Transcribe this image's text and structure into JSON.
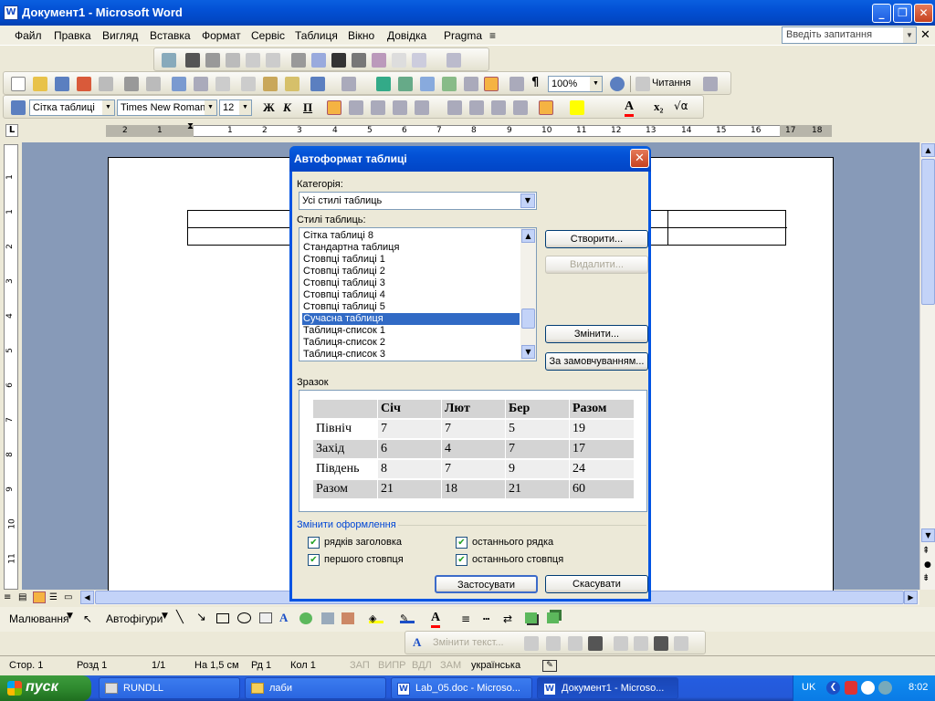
{
  "window": {
    "title": "Документ1 - Microsoft Word",
    "icon": "word-icon"
  },
  "menu": {
    "items": [
      "Файл",
      "Правка",
      "Вигляд",
      "Вставка",
      "Формат",
      "Сервіс",
      "Таблиця",
      "Вікно",
      "Довідка",
      "Pragma"
    ],
    "help_placeholder": "Введіть запитання"
  },
  "toolbar": {
    "zoom": "100%",
    "read_label": "Читання",
    "style": "Сітка таблиці",
    "font": "Times New Roman",
    "size": "12"
  },
  "ruler": {
    "h_numbers": [
      "2",
      "1",
      "1",
      "2",
      "3",
      "4",
      "5",
      "6",
      "7",
      "8",
      "9",
      "10",
      "11",
      "12",
      "13",
      "14",
      "15",
      "16",
      "17",
      "18"
    ],
    "v_numbers": [
      "1",
      "1",
      "2",
      "3",
      "4",
      "5",
      "6",
      "7",
      "8",
      "9",
      "10",
      "11"
    ]
  },
  "dialog": {
    "title": "Автоформат таблиці",
    "category_label": "Категорія:",
    "category_value": "Усі стилі таблиць",
    "styles_label": "Стилі таблиць:",
    "styles": [
      "Сітка таблиці 8",
      "Стандартна таблиця",
      "Стовпці таблиці 1",
      "Стовпці таблиці 2",
      "Стовпці таблиці 3",
      "Стовпці таблиці 4",
      "Стовпці таблиці 5",
      "Сучасна таблиця",
      "Таблиця-список 1",
      "Таблиця-список 2",
      "Таблиця-список 3"
    ],
    "selected_style": "Сучасна таблиця",
    "btn_create": "Створити...",
    "btn_delete": "Видалити...",
    "btn_modify": "Змінити...",
    "btn_default": "За замовчуванням...",
    "sample_label": "Зразок",
    "sample": {
      "header": [
        "",
        "Січ",
        "Лют",
        "Бер",
        "Разом"
      ],
      "rows": [
        [
          "Північ",
          "7",
          "7",
          "5",
          "19"
        ],
        [
          "Захід",
          "6",
          "4",
          "7",
          "17"
        ],
        [
          "Південь",
          "8",
          "7",
          "9",
          "24"
        ],
        [
          "Разом",
          "21",
          "18",
          "21",
          "60"
        ]
      ]
    },
    "apply_group": "Змінити оформлення",
    "chk_header_rows": "рядків заголовка",
    "chk_first_col": "першого стовпця",
    "chk_last_row": "останнього рядка",
    "chk_last_col": "останнього стовпця",
    "btn_apply": "Застосувати",
    "btn_cancel": "Скасувати"
  },
  "drawing": {
    "draw_label": "Малювання",
    "autoshapes_label": "Автофігури"
  },
  "wordart": {
    "change_text": "Змінити текст..."
  },
  "status": {
    "page": "Стор. 1",
    "section": "Розд 1",
    "pages": "1/1",
    "at": "На 1,5 см",
    "line": "Рд 1",
    "col": "Кол 1",
    "rec": "ЗАП",
    "trk": "ВИПР",
    "ext": "ВДЛ",
    "ovr": "ЗАМ",
    "lang": "українська"
  },
  "taskbar": {
    "start": "пуск",
    "tasks": [
      "RUNDLL",
      "лаби",
      "Lab_05.doc - Microso...",
      "Документ1 - Microso..."
    ],
    "lang": "UK",
    "clock": "8:02"
  },
  "colors": {
    "selection": "#316ac5",
    "titlebar": "#0350d4",
    "doc_background": "#879ab8"
  }
}
